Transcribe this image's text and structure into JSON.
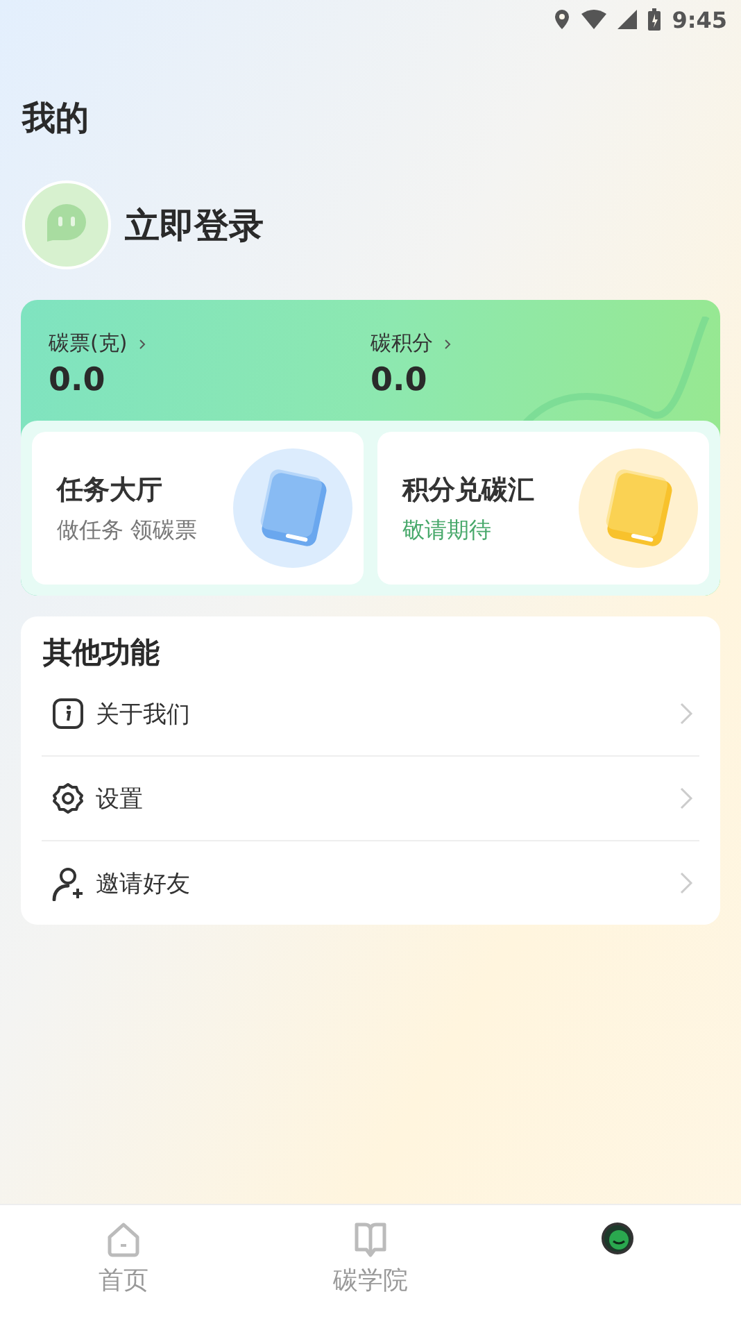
{
  "status_bar": {
    "time": "9:45"
  },
  "page_title": "我的",
  "profile": {
    "login_label": "立即登录"
  },
  "stats": [
    {
      "label": "碳票(克)",
      "value": "0.0"
    },
    {
      "label": "碳积分",
      "value": "0.0"
    }
  ],
  "tiles": [
    {
      "kind": "task",
      "title": "任务大厅",
      "subtitle": "做任务 领碳票"
    },
    {
      "kind": "exchange",
      "title": "积分兑碳汇",
      "subtitle": "敬请期待"
    }
  ],
  "other_functions": {
    "title": "其他功能",
    "items": [
      {
        "kind": "info",
        "label": "关于我们"
      },
      {
        "kind": "settings",
        "label": "设置"
      },
      {
        "kind": "invite",
        "label": "邀请好友"
      }
    ]
  },
  "bottom_nav": [
    {
      "kind": "home",
      "label": "首页",
      "selected": false
    },
    {
      "kind": "academy",
      "label": "碳学院",
      "selected": false
    },
    {
      "kind": "mine",
      "selected": true
    }
  ]
}
